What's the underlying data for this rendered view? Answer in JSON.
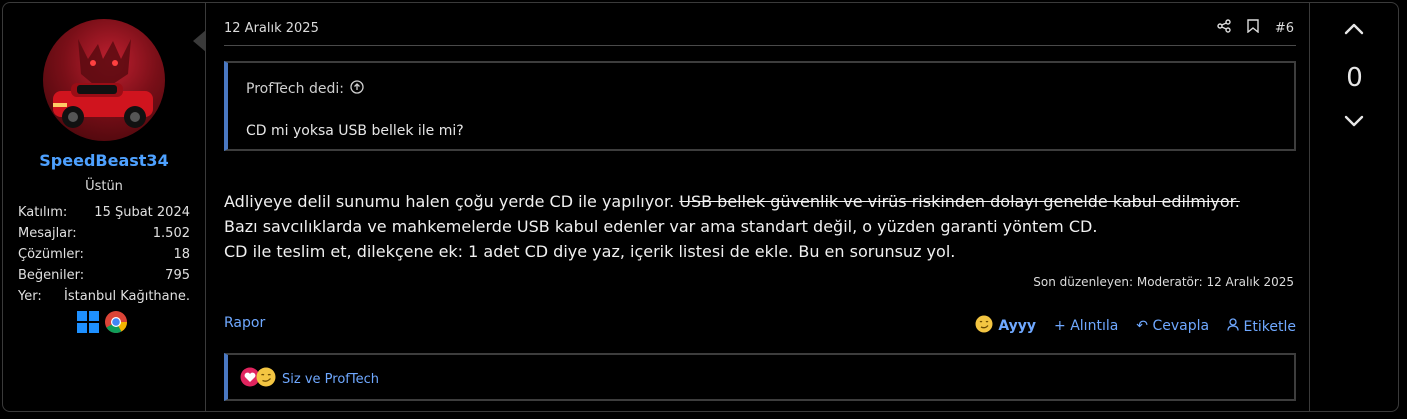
{
  "user": {
    "name": "SpeedBeast34",
    "title": "Üstün",
    "stats": [
      {
        "label": "Katılım:",
        "value": "15 Şubat 2024"
      },
      {
        "label": "Mesajlar:",
        "value": "1.502"
      },
      {
        "label": "Çözümler:",
        "value": "18"
      },
      {
        "label": "Beğeniler:",
        "value": "795"
      },
      {
        "label": "Yer:",
        "value": "İstanbul Kağıthane."
      }
    ]
  },
  "post": {
    "date": "12 Aralık 2025",
    "number": "#6",
    "quote": {
      "author": "ProfTech dedi:",
      "text": "CD mi yoksa USB bellek ile mi?"
    },
    "body": {
      "line1_normal": "Adliyeye delil sunumu halen çoğu yerde CD ile yapılıyor.",
      "line1_strike": "USB bellek güvenlik ve virüs riskinden dolayı genelde kabul edilmiyor.",
      "line2": "Bazı savcılıklarda ve mahkemelerde USB kabul edenler var ama standart değil, o yüzden garanti yöntem CD.",
      "line3": "CD ile teslim et, dilekçene ek: 1 adet CD diye yaz, içerik listesi de ekle. Bu en sorunsuz yol."
    },
    "edited": "Son düzenleyen: Moderatör: 12 Aralık 2025"
  },
  "footer": {
    "report": "Rapor",
    "ayyy": "Ayyy",
    "quote": "Alıntıla",
    "reply": "Cevapla",
    "tag": "Etiketle"
  },
  "reactions": {
    "text": "Siz ve ProfTech"
  },
  "vote": {
    "count": "0"
  },
  "colors": {
    "accent": "#4a78c2",
    "link": "#6fa8ff",
    "username": "#4ea1ff",
    "gold": "#f3c542"
  }
}
